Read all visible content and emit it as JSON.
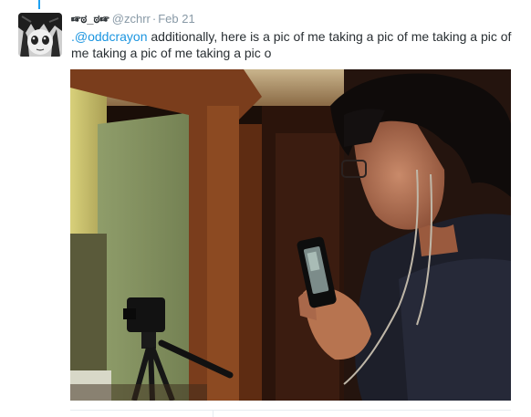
{
  "tweet": {
    "display_name": "☞ಠ_ಠ☞",
    "handle": "@zchrr",
    "separator": "·",
    "date": "Feb 21",
    "text_prefix": ".",
    "mention": "@oddcrayon",
    "text_body": " additionally, here is a pic of me taking a pic of me taking a pic of me taking a pic of me taking a pic o"
  },
  "icons": {
    "avatar": "anime-avatar-icon"
  },
  "colors": {
    "link": "#1b95e0",
    "thread_line": "#1da1f2",
    "meta_text": "#8899a6"
  }
}
